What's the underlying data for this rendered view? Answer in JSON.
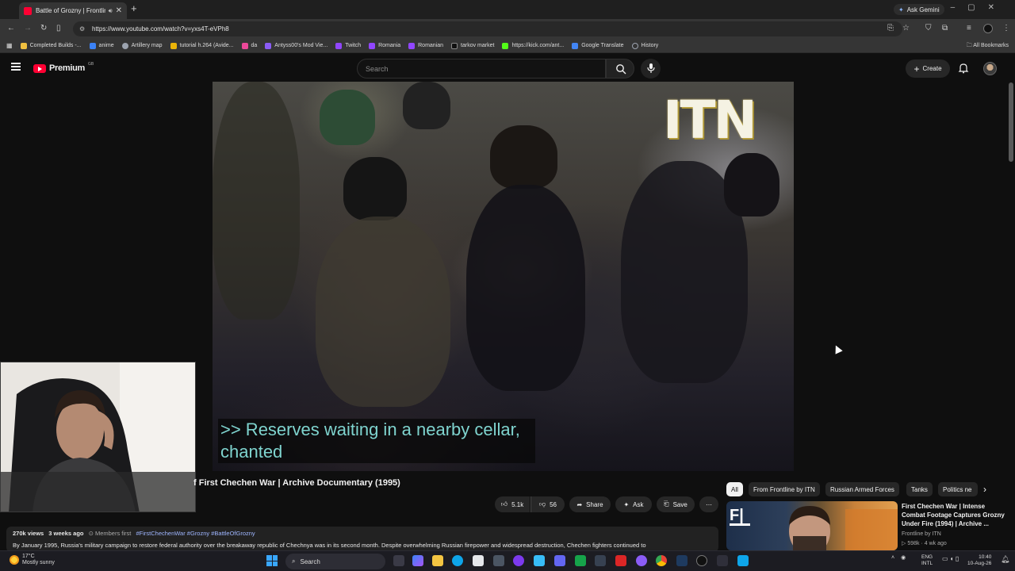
{
  "browser": {
    "tab_title": "Battle of Grozny | Frontline",
    "url": "https://www.youtube.com/watch?v=yxs4T-eVPh8",
    "ask_gemini": "Ask Gemini",
    "all_bookmarks": "All Bookmarks",
    "bookmarks": [
      {
        "label": "Completed Builds -...",
        "color": "#f0c040"
      },
      {
        "label": "anime",
        "color": "#3b82f6"
      },
      {
        "label": "Artillery map",
        "color": "#9ca3af"
      },
      {
        "label": "tutorial h.264 (Avide...",
        "color": "#eab308"
      },
      {
        "label": "da",
        "color": "#ec4899"
      },
      {
        "label": "Antyss00's Mod Vie...",
        "color": "#8b5cf6"
      },
      {
        "label": "Twitch",
        "color": "#9146ff"
      },
      {
        "label": "Romania",
        "color": "#9146ff"
      },
      {
        "label": "Romanian",
        "color": "#9146ff"
      },
      {
        "label": "tarkov market",
        "color": "#111111"
      },
      {
        "label": "https://kick.com/ant...",
        "color": "#53fc18"
      },
      {
        "label": "Google Translate",
        "color": "#4285f4"
      },
      {
        "label": "History",
        "color": "#9ca3af"
      }
    ]
  },
  "youtube": {
    "brand": "Premium",
    "country": "GB",
    "search_placeholder": "Search",
    "create_label": "Create"
  },
  "video": {
    "overlay_logo": "ITN",
    "caption_line1": ">> Reserves waiting in a nearby cellar,",
    "caption_line2": "chanted",
    "title_visible": "f First Chechen War | Archive Documentary (1995)",
    "likes": "5.1k",
    "dislikes": "56",
    "share_label": "Share",
    "ask_label": "Ask",
    "save_label": "Save",
    "views": "270k views",
    "age": "3 weeks ago",
    "members": "Members first",
    "hashtags": "#FirstChechenWar #Grozny #BattleOfGrozny",
    "description": "By January 1995, Russia's military campaign to restore federal authority over the breakaway republic of Chechnya was in its second month. Despite overwhelming Russian firepower and widespread destruction, Chechen fighters continued to"
  },
  "chips": [
    "All",
    "From Frontline by ITN",
    "Russian Armed Forces",
    "Tanks",
    "Politics ne"
  ],
  "recommendation": {
    "title": "First Chechen War | Intense Combat Footage Captures Grozny Under Fire (1994) | Archive ...",
    "channel": "Frontline by ITN",
    "views": "598k",
    "age": "4 wk ago"
  },
  "taskbar": {
    "temp": "17°C",
    "weather": "Mostly sunny",
    "search": "Search",
    "lang1": "ENG",
    "lang2": "INTL",
    "time": "10:40",
    "date": "10-Aug-26"
  }
}
